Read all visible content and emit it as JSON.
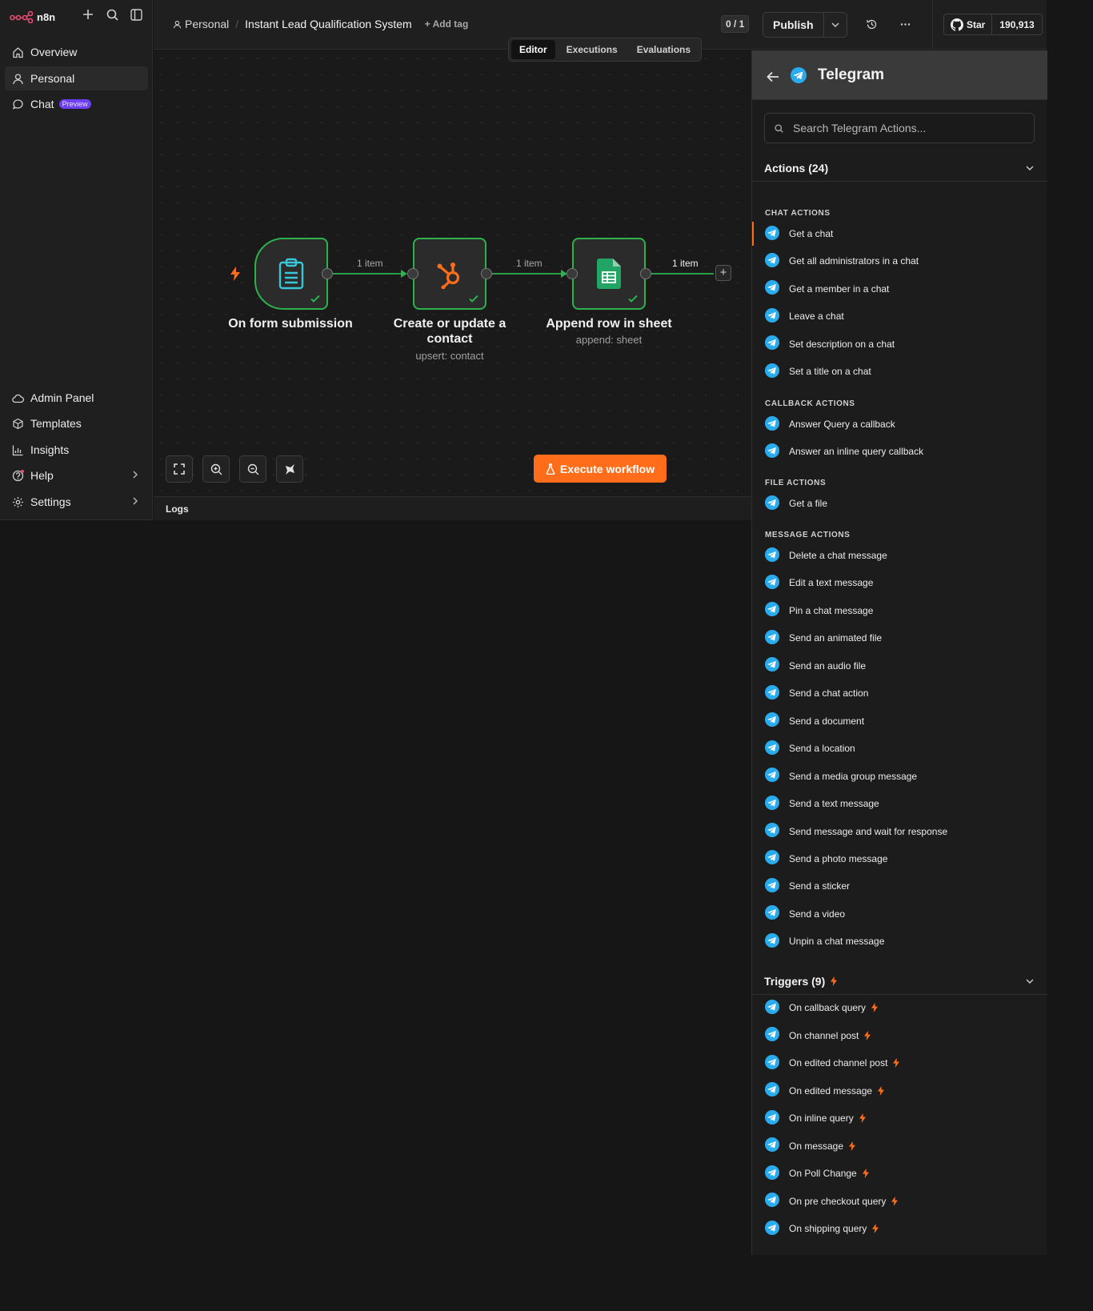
{
  "app": {
    "name": "n8n"
  },
  "sidebar": {
    "top_items": [
      {
        "label": "Overview",
        "icon": "home-icon"
      },
      {
        "label": "Personal",
        "icon": "user-icon"
      },
      {
        "label": "Chat",
        "icon": "chat-icon",
        "badge": "Preview"
      }
    ],
    "bottom_items": [
      {
        "label": "Admin Panel",
        "icon": "cloud-icon"
      },
      {
        "label": "Templates",
        "icon": "box-icon"
      },
      {
        "label": "Insights",
        "icon": "bar-chart-icon"
      },
      {
        "label": "Help",
        "icon": "help-circle-icon"
      },
      {
        "label": "Settings",
        "icon": "gear-icon"
      }
    ]
  },
  "header": {
    "breadcrumb_project": "Personal",
    "workflow_name": "Instant Lead Qualification System",
    "add_tag": "+ Add tag",
    "counter": "0 / 1",
    "publish_label": "Publish",
    "github_star": "Star",
    "github_count": "190,913"
  },
  "canvas": {
    "tabs": [
      "Editor",
      "Executions",
      "Evaluations"
    ],
    "active_tab": "Editor",
    "nodes": [
      {
        "label": "On form submission",
        "subtitle": "",
        "icon": "clipboard-icon"
      },
      {
        "label": "Create or update a contact",
        "subtitle": "upsert: contact",
        "icon": "hubspot-icon"
      },
      {
        "label": "Append row in sheet",
        "subtitle": "append: sheet",
        "icon": "google-sheets-icon"
      }
    ],
    "edges": [
      "1 item",
      "1 item",
      "1 item"
    ],
    "execute_label": "Execute workflow",
    "logs_label": "Logs"
  },
  "panel": {
    "title": "Telegram",
    "search_placeholder": "Search Telegram Actions...",
    "actions_header": "Actions (24)",
    "groups": [
      {
        "title": "CHAT ACTIONS",
        "items": [
          "Get a chat",
          "Get all administrators in a chat",
          "Get a member in a chat",
          "Leave a chat",
          "Set description on a chat",
          "Set a title on a chat"
        ]
      },
      {
        "title": "CALLBACK ACTIONS",
        "items": [
          "Answer Query a callback",
          "Answer an inline query callback"
        ]
      },
      {
        "title": "FILE ACTIONS",
        "items": [
          "Get a file"
        ]
      },
      {
        "title": "MESSAGE ACTIONS",
        "items": [
          "Delete a chat message",
          "Edit a text message",
          "Pin a chat message",
          "Send an animated file",
          "Send an audio file",
          "Send a chat action",
          "Send a document",
          "Send a location",
          "Send a media group message",
          "Send a text message",
          "Send message and wait for response",
          "Send a photo message",
          "Send a sticker",
          "Send a video",
          "Unpin a chat message"
        ]
      }
    ],
    "triggers_header": "Triggers (9)",
    "triggers": [
      "On callback query",
      "On channel post",
      "On edited channel post",
      "On edited message",
      "On inline query",
      "On message",
      "On Poll Change",
      "On pre checkout query",
      "On shipping query"
    ]
  },
  "colors": {
    "accent": "#ff6d1a",
    "success": "#2cb14d",
    "telegram": "#2aabee",
    "badge": "#6c3ff0",
    "logo": "#ea4b71"
  }
}
